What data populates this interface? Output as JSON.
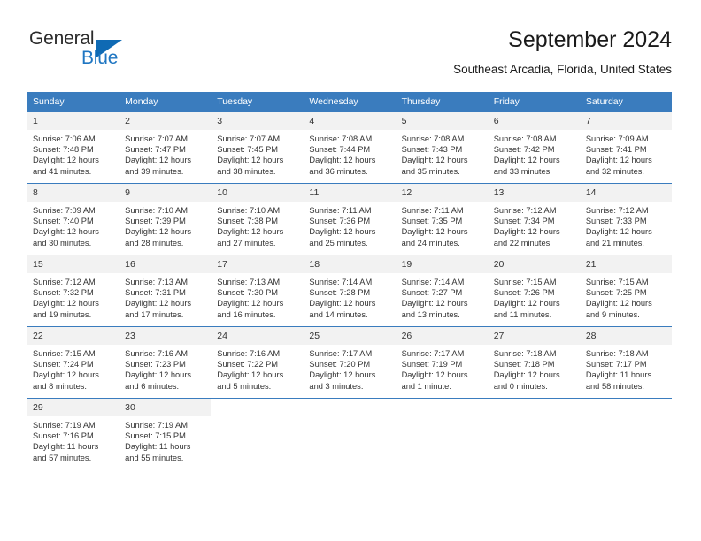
{
  "brand": {
    "name_part1": "General",
    "name_part2": "Blue",
    "logo_icon": "blue-triangle-icon"
  },
  "header": {
    "title": "September 2024",
    "subtitle": "Southeast Arcadia, Florida, United States"
  },
  "colors": {
    "header_blue": "#3a7cbe",
    "brand_blue": "#1f76c2",
    "daynum_band": "#f2f2f2",
    "text": "#333333"
  },
  "weekday_headers": [
    "Sunday",
    "Monday",
    "Tuesday",
    "Wednesday",
    "Thursday",
    "Friday",
    "Saturday"
  ],
  "labels": {
    "sunrise_prefix": "Sunrise:",
    "sunset_prefix": "Sunset:",
    "daylight_prefix": "Daylight:"
  },
  "weeks": [
    [
      {
        "day": "1",
        "sunrise": "Sunrise: 7:06 AM",
        "sunset": "Sunset: 7:48 PM",
        "daylight_1": "Daylight: 12 hours",
        "daylight_2": "and 41 minutes."
      },
      {
        "day": "2",
        "sunrise": "Sunrise: 7:07 AM",
        "sunset": "Sunset: 7:47 PM",
        "daylight_1": "Daylight: 12 hours",
        "daylight_2": "and 39 minutes."
      },
      {
        "day": "3",
        "sunrise": "Sunrise: 7:07 AM",
        "sunset": "Sunset: 7:45 PM",
        "daylight_1": "Daylight: 12 hours",
        "daylight_2": "and 38 minutes."
      },
      {
        "day": "4",
        "sunrise": "Sunrise: 7:08 AM",
        "sunset": "Sunset: 7:44 PM",
        "daylight_1": "Daylight: 12 hours",
        "daylight_2": "and 36 minutes."
      },
      {
        "day": "5",
        "sunrise": "Sunrise: 7:08 AM",
        "sunset": "Sunset: 7:43 PM",
        "daylight_1": "Daylight: 12 hours",
        "daylight_2": "and 35 minutes."
      },
      {
        "day": "6",
        "sunrise": "Sunrise: 7:08 AM",
        "sunset": "Sunset: 7:42 PM",
        "daylight_1": "Daylight: 12 hours",
        "daylight_2": "and 33 minutes."
      },
      {
        "day": "7",
        "sunrise": "Sunrise: 7:09 AM",
        "sunset": "Sunset: 7:41 PM",
        "daylight_1": "Daylight: 12 hours",
        "daylight_2": "and 32 minutes."
      }
    ],
    [
      {
        "day": "8",
        "sunrise": "Sunrise: 7:09 AM",
        "sunset": "Sunset: 7:40 PM",
        "daylight_1": "Daylight: 12 hours",
        "daylight_2": "and 30 minutes."
      },
      {
        "day": "9",
        "sunrise": "Sunrise: 7:10 AM",
        "sunset": "Sunset: 7:39 PM",
        "daylight_1": "Daylight: 12 hours",
        "daylight_2": "and 28 minutes."
      },
      {
        "day": "10",
        "sunrise": "Sunrise: 7:10 AM",
        "sunset": "Sunset: 7:38 PM",
        "daylight_1": "Daylight: 12 hours",
        "daylight_2": "and 27 minutes."
      },
      {
        "day": "11",
        "sunrise": "Sunrise: 7:11 AM",
        "sunset": "Sunset: 7:36 PM",
        "daylight_1": "Daylight: 12 hours",
        "daylight_2": "and 25 minutes."
      },
      {
        "day": "12",
        "sunrise": "Sunrise: 7:11 AM",
        "sunset": "Sunset: 7:35 PM",
        "daylight_1": "Daylight: 12 hours",
        "daylight_2": "and 24 minutes."
      },
      {
        "day": "13",
        "sunrise": "Sunrise: 7:12 AM",
        "sunset": "Sunset: 7:34 PM",
        "daylight_1": "Daylight: 12 hours",
        "daylight_2": "and 22 minutes."
      },
      {
        "day": "14",
        "sunrise": "Sunrise: 7:12 AM",
        "sunset": "Sunset: 7:33 PM",
        "daylight_1": "Daylight: 12 hours",
        "daylight_2": "and 21 minutes."
      }
    ],
    [
      {
        "day": "15",
        "sunrise": "Sunrise: 7:12 AM",
        "sunset": "Sunset: 7:32 PM",
        "daylight_1": "Daylight: 12 hours",
        "daylight_2": "and 19 minutes."
      },
      {
        "day": "16",
        "sunrise": "Sunrise: 7:13 AM",
        "sunset": "Sunset: 7:31 PM",
        "daylight_1": "Daylight: 12 hours",
        "daylight_2": "and 17 minutes."
      },
      {
        "day": "17",
        "sunrise": "Sunrise: 7:13 AM",
        "sunset": "Sunset: 7:30 PM",
        "daylight_1": "Daylight: 12 hours",
        "daylight_2": "and 16 minutes."
      },
      {
        "day": "18",
        "sunrise": "Sunrise: 7:14 AM",
        "sunset": "Sunset: 7:28 PM",
        "daylight_1": "Daylight: 12 hours",
        "daylight_2": "and 14 minutes."
      },
      {
        "day": "19",
        "sunrise": "Sunrise: 7:14 AM",
        "sunset": "Sunset: 7:27 PM",
        "daylight_1": "Daylight: 12 hours",
        "daylight_2": "and 13 minutes."
      },
      {
        "day": "20",
        "sunrise": "Sunrise: 7:15 AM",
        "sunset": "Sunset: 7:26 PM",
        "daylight_1": "Daylight: 12 hours",
        "daylight_2": "and 11 minutes."
      },
      {
        "day": "21",
        "sunrise": "Sunrise: 7:15 AM",
        "sunset": "Sunset: 7:25 PM",
        "daylight_1": "Daylight: 12 hours",
        "daylight_2": "and 9 minutes."
      }
    ],
    [
      {
        "day": "22",
        "sunrise": "Sunrise: 7:15 AM",
        "sunset": "Sunset: 7:24 PM",
        "daylight_1": "Daylight: 12 hours",
        "daylight_2": "and 8 minutes."
      },
      {
        "day": "23",
        "sunrise": "Sunrise: 7:16 AM",
        "sunset": "Sunset: 7:23 PM",
        "daylight_1": "Daylight: 12 hours",
        "daylight_2": "and 6 minutes."
      },
      {
        "day": "24",
        "sunrise": "Sunrise: 7:16 AM",
        "sunset": "Sunset: 7:22 PM",
        "daylight_1": "Daylight: 12 hours",
        "daylight_2": "and 5 minutes."
      },
      {
        "day": "25",
        "sunrise": "Sunrise: 7:17 AM",
        "sunset": "Sunset: 7:20 PM",
        "daylight_1": "Daylight: 12 hours",
        "daylight_2": "and 3 minutes."
      },
      {
        "day": "26",
        "sunrise": "Sunrise: 7:17 AM",
        "sunset": "Sunset: 7:19 PM",
        "daylight_1": "Daylight: 12 hours",
        "daylight_2": "and 1 minute."
      },
      {
        "day": "27",
        "sunrise": "Sunrise: 7:18 AM",
        "sunset": "Sunset: 7:18 PM",
        "daylight_1": "Daylight: 12 hours",
        "daylight_2": "and 0 minutes."
      },
      {
        "day": "28",
        "sunrise": "Sunrise: 7:18 AM",
        "sunset": "Sunset: 7:17 PM",
        "daylight_1": "Daylight: 11 hours",
        "daylight_2": "and 58 minutes."
      }
    ],
    [
      {
        "day": "29",
        "sunrise": "Sunrise: 7:19 AM",
        "sunset": "Sunset: 7:16 PM",
        "daylight_1": "Daylight: 11 hours",
        "daylight_2": "and 57 minutes."
      },
      {
        "day": "30",
        "sunrise": "Sunrise: 7:19 AM",
        "sunset": "Sunset: 7:15 PM",
        "daylight_1": "Daylight: 11 hours",
        "daylight_2": "and 55 minutes."
      },
      {
        "day": "",
        "sunrise": "",
        "sunset": "",
        "daylight_1": "",
        "daylight_2": ""
      },
      {
        "day": "",
        "sunrise": "",
        "sunset": "",
        "daylight_1": "",
        "daylight_2": ""
      },
      {
        "day": "",
        "sunrise": "",
        "sunset": "",
        "daylight_1": "",
        "daylight_2": ""
      },
      {
        "day": "",
        "sunrise": "",
        "sunset": "",
        "daylight_1": "",
        "daylight_2": ""
      },
      {
        "day": "",
        "sunrise": "",
        "sunset": "",
        "daylight_1": "",
        "daylight_2": ""
      }
    ]
  ]
}
